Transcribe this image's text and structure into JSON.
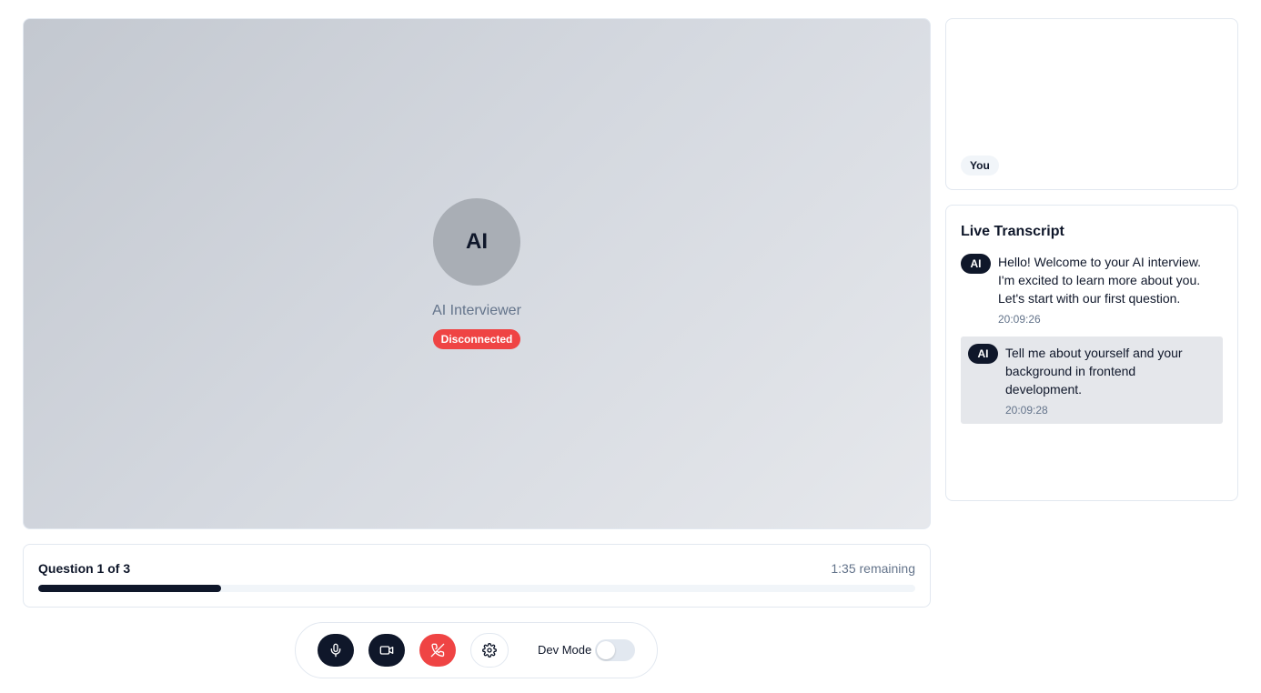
{
  "ai_panel": {
    "avatar_text": "AI",
    "name": "AI Interviewer",
    "status": "Disconnected",
    "status_color": "#ef4444"
  },
  "self_view": {
    "label": "You"
  },
  "transcript": {
    "title": "Live Transcript",
    "messages": [
      {
        "speaker": "AI",
        "text": "Hello! Welcome to your AI interview. I'm excited to learn more about you. Let's start with our first question.",
        "time": "20:09:26",
        "highlighted": false
      },
      {
        "speaker": "AI",
        "text": "Tell me about yourself and your background in frontend development.",
        "time": "20:09:28",
        "highlighted": true
      }
    ]
  },
  "progress": {
    "question_label": "Question 1 of 3",
    "remaining": "1:35 remaining",
    "fraction": 0.208
  },
  "controls": {
    "buttons": [
      {
        "name": "microphone",
        "icon": "mic-icon"
      },
      {
        "name": "camera",
        "icon": "video-camera-icon"
      },
      {
        "name": "end-call",
        "icon": "phone-off-icon"
      },
      {
        "name": "settings",
        "icon": "gear-icon"
      }
    ],
    "dev_mode_label": "Dev Mode",
    "dev_mode_enabled": false
  },
  "colors": {
    "primary": "#0f172a",
    "danger": "#ef4444",
    "muted": "#64748b",
    "border": "#e2e8f0"
  }
}
